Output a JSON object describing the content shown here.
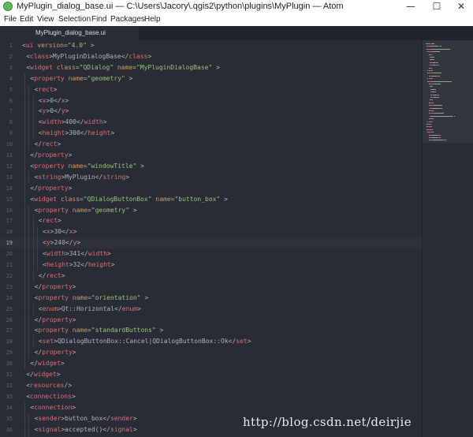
{
  "window": {
    "title": "MyPlugin_dialog_base.ui — C:\\Users\\Jacory\\.qgis2\\python\\plugins\\MyPlugin — Atom",
    "minimize_glyph": "—",
    "maximize_glyph": "☐",
    "close_glyph": "✕"
  },
  "menu": [
    "File",
    "Edit",
    "View",
    "Selection",
    "Find",
    "Packages",
    "Help"
  ],
  "tab": {
    "label": "MyPlugin_dialog_base.ui"
  },
  "colors": {
    "background": "#282c34",
    "tag": "#e06c75",
    "attribute": "#d19a66",
    "string": "#98c379",
    "text": "#abb2bf"
  },
  "cursor_line": 19,
  "code_lines": [
    [
      [
        "t",
        "<"
      ],
      [
        "g",
        "ui "
      ],
      [
        "a",
        "version"
      ],
      [
        "t",
        "="
      ],
      [
        "s",
        "\"4.0\""
      ],
      [
        "t",
        " >"
      ]
    ],
    [
      [
        "t",
        "<"
      ],
      [
        "g",
        "class"
      ],
      [
        "t",
        ">MyPluginDialogBase</"
      ],
      [
        "g",
        "class"
      ],
      [
        "t",
        ">"
      ]
    ],
    [
      [
        "t",
        "<"
      ],
      [
        "g",
        "widget "
      ],
      [
        "a",
        "class"
      ],
      [
        "t",
        "="
      ],
      [
        "s",
        "\"QDialog\""
      ],
      [
        "t",
        " "
      ],
      [
        "a",
        "name"
      ],
      [
        "t",
        "="
      ],
      [
        "s",
        "\"MyPluginDialogBase\""
      ],
      [
        "t",
        " >"
      ]
    ],
    [
      [
        "t",
        "<"
      ],
      [
        "g",
        "property "
      ],
      [
        "a",
        "name"
      ],
      [
        "t",
        "="
      ],
      [
        "s",
        "\"geometry\""
      ],
      [
        "t",
        " >"
      ]
    ],
    [
      [
        "t",
        "<"
      ],
      [
        "g",
        "rect"
      ],
      [
        "t",
        ">"
      ]
    ],
    [
      [
        "t",
        "<"
      ],
      [
        "g",
        "x"
      ],
      [
        "t",
        ">0</"
      ],
      [
        "g",
        "x"
      ],
      [
        "t",
        ">"
      ]
    ],
    [
      [
        "t",
        "<"
      ],
      [
        "g",
        "y"
      ],
      [
        "t",
        ">0</"
      ],
      [
        "g",
        "y"
      ],
      [
        "t",
        ">"
      ]
    ],
    [
      [
        "t",
        "<"
      ],
      [
        "g",
        "width"
      ],
      [
        "t",
        ">400</"
      ],
      [
        "g",
        "width"
      ],
      [
        "t",
        ">"
      ]
    ],
    [
      [
        "t",
        "<"
      ],
      [
        "g",
        "height"
      ],
      [
        "t",
        ">300</"
      ],
      [
        "g",
        "height"
      ],
      [
        "t",
        ">"
      ]
    ],
    [
      [
        "t",
        "</"
      ],
      [
        "g",
        "rect"
      ],
      [
        "t",
        ">"
      ]
    ],
    [
      [
        "t",
        "</"
      ],
      [
        "g",
        "property"
      ],
      [
        "t",
        ">"
      ]
    ],
    [
      [
        "t",
        "<"
      ],
      [
        "g",
        "property "
      ],
      [
        "a",
        "name"
      ],
      [
        "t",
        "="
      ],
      [
        "s",
        "\"windowTitle\""
      ],
      [
        "t",
        " >"
      ]
    ],
    [
      [
        "t",
        "<"
      ],
      [
        "g",
        "string"
      ],
      [
        "t",
        ">MyPlugin</"
      ],
      [
        "g",
        "string"
      ],
      [
        "t",
        ">"
      ]
    ],
    [
      [
        "t",
        "</"
      ],
      [
        "g",
        "property"
      ],
      [
        "t",
        ">"
      ]
    ],
    [
      [
        "t",
        "<"
      ],
      [
        "g",
        "widget "
      ],
      [
        "a",
        "class"
      ],
      [
        "t",
        "="
      ],
      [
        "s",
        "\"QDialogButtonBox\""
      ],
      [
        "t",
        " "
      ],
      [
        "a",
        "name"
      ],
      [
        "t",
        "="
      ],
      [
        "s",
        "\"button_box\""
      ],
      [
        "t",
        " >"
      ]
    ],
    [
      [
        "t",
        "<"
      ],
      [
        "g",
        "property "
      ],
      [
        "a",
        "name"
      ],
      [
        "t",
        "="
      ],
      [
        "s",
        "\"geometry\""
      ],
      [
        "t",
        " >"
      ]
    ],
    [
      [
        "t",
        "<"
      ],
      [
        "g",
        "rect"
      ],
      [
        "t",
        ">"
      ]
    ],
    [
      [
        "t",
        "<"
      ],
      [
        "g",
        "x"
      ],
      [
        "t",
        ">30</"
      ],
      [
        "g",
        "x"
      ],
      [
        "t",
        ">"
      ]
    ],
    [
      [
        "t",
        "<"
      ],
      [
        "g",
        "y"
      ],
      [
        "t",
        ">240</"
      ],
      [
        "g",
        "y"
      ],
      [
        "t",
        ">"
      ]
    ],
    [
      [
        "t",
        "<"
      ],
      [
        "g",
        "width"
      ],
      [
        "t",
        ">341</"
      ],
      [
        "g",
        "width"
      ],
      [
        "t",
        ">"
      ]
    ],
    [
      [
        "t",
        "<"
      ],
      [
        "g",
        "height"
      ],
      [
        "t",
        ">32</"
      ],
      [
        "g",
        "height"
      ],
      [
        "t",
        ">"
      ]
    ],
    [
      [
        "t",
        "</"
      ],
      [
        "g",
        "rect"
      ],
      [
        "t",
        ">"
      ]
    ],
    [
      [
        "t",
        "</"
      ],
      [
        "g",
        "property"
      ],
      [
        "t",
        ">"
      ]
    ],
    [
      [
        "t",
        "<"
      ],
      [
        "g",
        "property "
      ],
      [
        "a",
        "name"
      ],
      [
        "t",
        "="
      ],
      [
        "s",
        "\"orientation\""
      ],
      [
        "t",
        " >"
      ]
    ],
    [
      [
        "t",
        "<"
      ],
      [
        "g",
        "enum"
      ],
      [
        "t",
        ">Qt::Horizontal</"
      ],
      [
        "g",
        "enum"
      ],
      [
        "t",
        ">"
      ]
    ],
    [
      [
        "t",
        "</"
      ],
      [
        "g",
        "property"
      ],
      [
        "t",
        ">"
      ]
    ],
    [
      [
        "t",
        "<"
      ],
      [
        "g",
        "property "
      ],
      [
        "a",
        "name"
      ],
      [
        "t",
        "="
      ],
      [
        "s",
        "\"standardButtons\""
      ],
      [
        "t",
        " >"
      ]
    ],
    [
      [
        "t",
        "<"
      ],
      [
        "g",
        "set"
      ],
      [
        "t",
        ">QDialogButtonBox::Cancel|QDialogButtonBox::Ok</"
      ],
      [
        "g",
        "set"
      ],
      [
        "t",
        ">"
      ]
    ],
    [
      [
        "t",
        "</"
      ],
      [
        "g",
        "property"
      ],
      [
        "t",
        ">"
      ]
    ],
    [
      [
        "t",
        "</"
      ],
      [
        "g",
        "widget"
      ],
      [
        "t",
        ">"
      ]
    ],
    [
      [
        "t",
        "</"
      ],
      [
        "g",
        "widget"
      ],
      [
        "t",
        ">"
      ]
    ],
    [
      [
        "t",
        "<"
      ],
      [
        "g",
        "resources"
      ],
      [
        "t",
        "/>"
      ]
    ],
    [
      [
        "t",
        "<"
      ],
      [
        "g",
        "connections"
      ],
      [
        "t",
        ">"
      ]
    ],
    [
      [
        "t",
        "<"
      ],
      [
        "g",
        "connection"
      ],
      [
        "t",
        ">"
      ]
    ],
    [
      [
        "t",
        "<"
      ],
      [
        "g",
        "sender"
      ],
      [
        "t",
        ">button_box</"
      ],
      [
        "g",
        "sender"
      ],
      [
        "t",
        ">"
      ]
    ],
    [
      [
        "t",
        "<"
      ],
      [
        "g",
        "signal"
      ],
      [
        "t",
        ">accepted()</"
      ],
      [
        "g",
        "signal"
      ],
      [
        "t",
        ">"
      ]
    ],
    [
      [
        "t",
        "<"
      ],
      [
        "g",
        "receiver"
      ],
      [
        "t",
        ">MyPluginDialogBase</"
      ],
      [
        "g",
        "receiver"
      ],
      [
        "t",
        ">"
      ]
    ]
  ],
  "watermark": "http://blog.csdn.net/deirjie"
}
